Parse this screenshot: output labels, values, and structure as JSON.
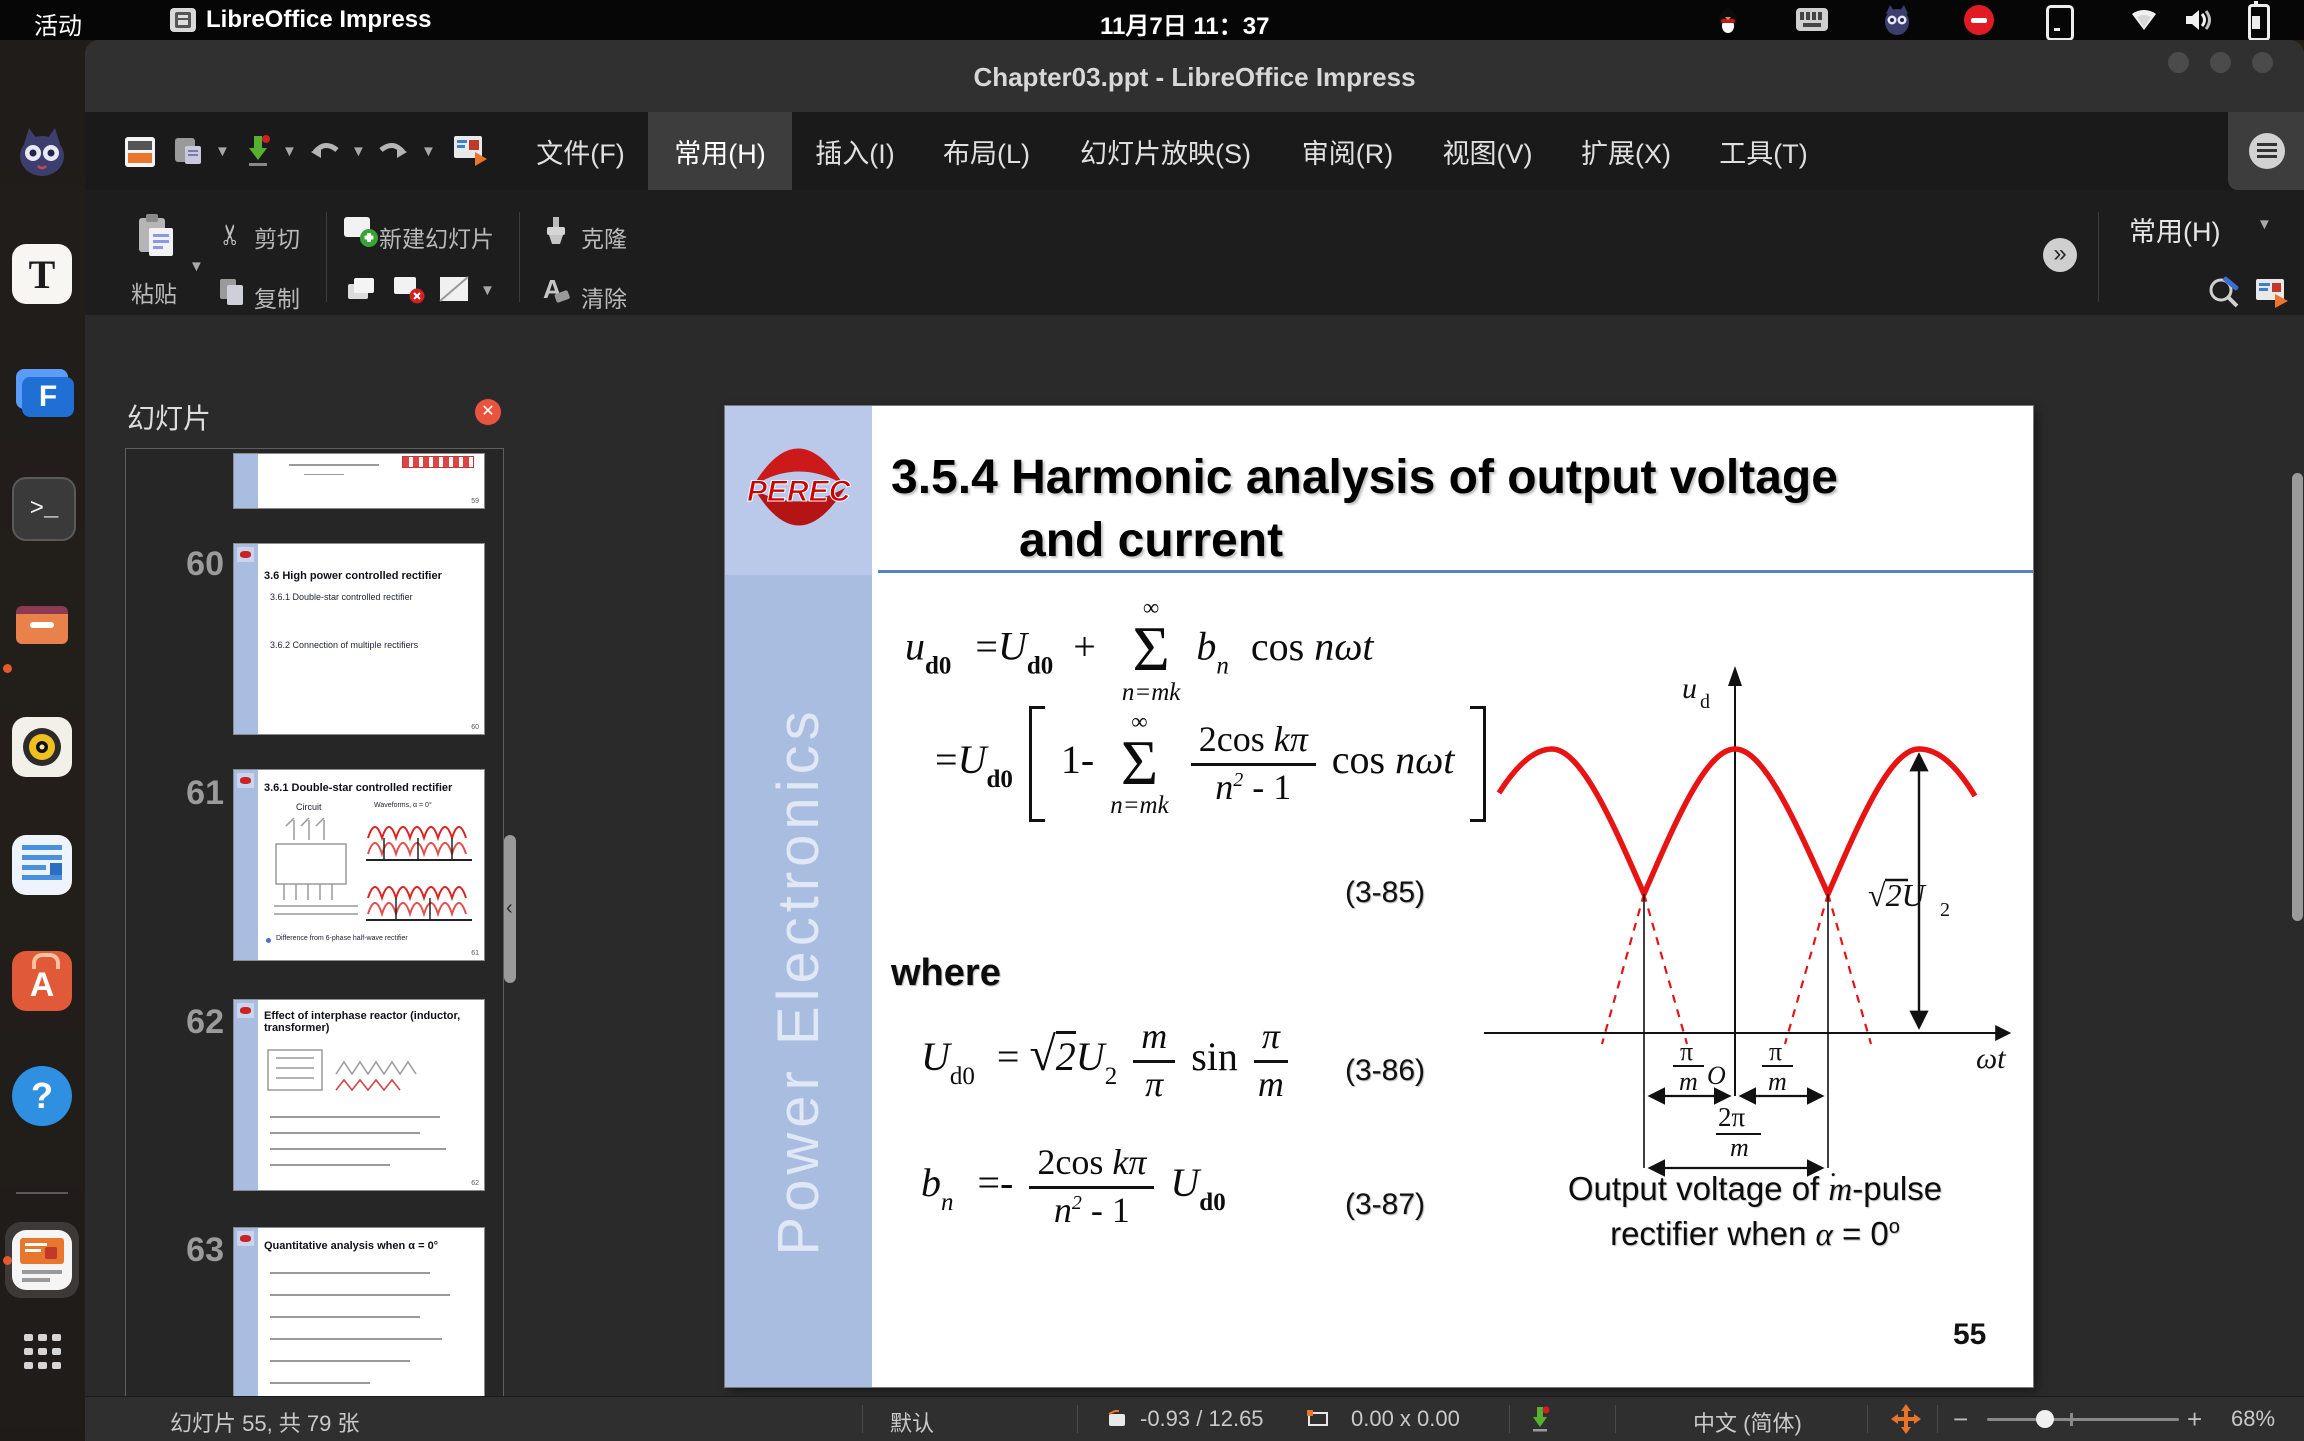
{
  "topbar": {
    "activities": "活动",
    "app_name": "LibreOffice Impress",
    "clock": "11月7日 11：37",
    "tray": [
      "qq-penguin",
      "keyboard",
      "chat-cat",
      "do-not-disturb",
      "tablet",
      "wifi",
      "volume",
      "battery"
    ]
  },
  "titlebar": {
    "title": "Chapter03.ppt - LibreOffice Impress"
  },
  "menubar": {
    "tabs": [
      {
        "label": "文件(F)"
      },
      {
        "label": "常用(H)"
      },
      {
        "label": "插入(I)"
      },
      {
        "label": "布局(L)"
      },
      {
        "label": "幻灯片放映(S)"
      },
      {
        "label": "审阅(R)"
      },
      {
        "label": "视图(V)"
      },
      {
        "label": "扩展(X)"
      },
      {
        "label": "工具(T)"
      }
    ]
  },
  "toolbar": {
    "paste": "粘贴",
    "cut": "剪切",
    "copy": "复制",
    "new_slide": "新建幻灯片",
    "clone": "克隆",
    "clear": "清除",
    "overflow": "»",
    "tab_selector": "常用(H)"
  },
  "panel": {
    "title": "幻灯片",
    "slides": [
      {
        "number": "",
        "page": "59"
      },
      {
        "number": "60",
        "title": "3.6  High power controlled rectifier",
        "lines": [
          "3.6.1 Double-star controlled rectifier",
          "3.6.2 Connection of multiple rectifiers"
        ],
        "page": "60"
      },
      {
        "number": "61",
        "title": "3.6.1 Double-star controlled rectifier",
        "lines": [
          "Circuit",
          "Waveforms, α = 0°",
          "Difference from 6-phase half-wave rectifier"
        ],
        "page": "61"
      },
      {
        "number": "62",
        "title": "Effect of interphase reactor (inductor, transformer)",
        "lines": [],
        "page": "62"
      },
      {
        "number": "63",
        "title": "Quantitative analysis when α = 0°",
        "lines": [],
        "page": "63"
      }
    ]
  },
  "slide": {
    "logo": "PEREC",
    "side_text": "Power Electronics",
    "title_line1": "3.5.4 Harmonic analysis of output voltage",
    "title_line2": "and current",
    "eq1": {
      "lhs": "u",
      "lhs_sub": "d0",
      "rel": "=",
      "t1": "U",
      "t1_sub": "d0",
      "op": "+",
      "sum_sup": "∞",
      "sum": "Σ",
      "sum_sub": "n=mk",
      "t2": "b",
      "t2_sub": "n",
      "cos": "cos ",
      "arg": "nωt"
    },
    "eq2": {
      "rel": "=",
      "t1": "U",
      "t1_sub": "d0",
      "one": "1-",
      "sum_sup": "∞",
      "sum": "Σ",
      "sum_sub": "n=mk",
      "num_up": "2cos ",
      "num_it": "kπ",
      "den_n": "n",
      "den_sup": "2",
      "den_tail": " - 1",
      "cos": "cos ",
      "arg": "nωt"
    },
    "eq1_no": "(3-85)",
    "where": "where",
    "eq3": {
      "lhs": "U",
      "lhs_sub": "d0",
      "rel": "=",
      "root": "√",
      "rad": "2",
      "U2": "U",
      "U2_sub": "2",
      "num": "m",
      "den": "π",
      "sin": "sin",
      "num2": "π",
      "den2": "m"
    },
    "eq3_no": "(3-86)",
    "eq4": {
      "lhs": "b",
      "lhs_sub": "n",
      "rel": "=-",
      "num_up": "2cos ",
      "num_it": "kπ",
      "den_n": "n",
      "den_sup": "2",
      "den_tail": " - 1",
      "t1": "U",
      "t1_sub": "d0"
    },
    "eq4_no": "(3-87)",
    "graph": {
      "u": "u",
      "u_sub": "d",
      "omega_t": "ωt",
      "amp": "√2U",
      "amp_sub": "2",
      "pi_left_num": "π",
      "pi_left_den": "m",
      "origin": "O",
      "pi_right_num": "π",
      "pi_right_den": "m",
      "two_pi_num": "2π",
      "two_pi_den": "m",
      "dot": "."
    },
    "caption_1a": "Output voltage of ",
    "caption_1m": "m",
    "caption_1b": "-pulse",
    "caption_2a": "rectifier when ",
    "caption_2alpha": "α",
    "caption_2b": " =  0",
    "caption_2sup": "o",
    "page": "55"
  },
  "statusbar": {
    "slide_info": "幻灯片 55, 共 79 张",
    "style": "默认",
    "position": "-0.93 / 12.65",
    "size": "0.00 x 0.00",
    "language": "中文 (简体)",
    "zoom_minus": "−",
    "zoom_plus": "+",
    "zoom_level": "68%"
  },
  "dock": {
    "items": [
      "chat-cat",
      "text-editor",
      "files-f",
      "terminal",
      "file-manager",
      "music-player",
      "writer-document",
      "app-store",
      "help",
      "impress",
      "app-grid"
    ]
  },
  "accent_colors": {
    "waveform_red": "#e81313",
    "band_blue": "#a9bde0",
    "ubuntu_orange": "#e4592d"
  }
}
